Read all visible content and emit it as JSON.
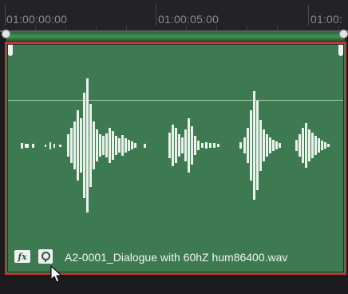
{
  "ruler": {
    "timecodes": [
      "01:00:00:00",
      "01:00:05:00",
      "01:00:"
    ]
  },
  "clip": {
    "name": "A2-0001_Dialogue with 60hZ hum86400.wav",
    "fx_label": "fx",
    "color": "#3d7a51",
    "selected_border_color": "#c9342a"
  },
  "icons": {
    "fx_button": "fx-icon",
    "clip_icon": "pin-icon",
    "cursor": "pointer-cursor-icon"
  }
}
